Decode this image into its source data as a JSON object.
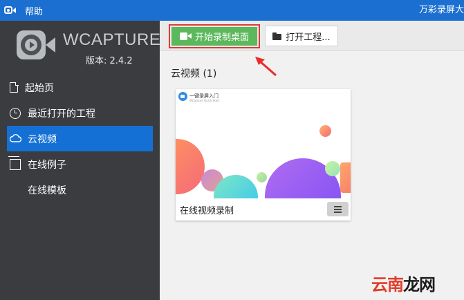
{
  "titlebar": {
    "menu_help": "帮助",
    "title": "万彩录屏大"
  },
  "sidebar": {
    "brand": "WCAPTURE",
    "version": "版本: 2.4.2",
    "items": [
      {
        "label": "起始页",
        "icon": "document-icon"
      },
      {
        "label": "最近打开的工程",
        "icon": "clock-icon"
      },
      {
        "label": "云视频",
        "icon": "cloud-icon",
        "active": true
      },
      {
        "label": "在线例子",
        "icon": "box-icon"
      },
      {
        "label": "在线模板",
        "icon": ""
      }
    ]
  },
  "toolbar": {
    "record_label": "开始录制桌面",
    "open_label": "打开工程..."
  },
  "main": {
    "section_title": "云视频 (1)",
    "cards": [
      {
        "label": "在线视频录制",
        "thumb_title": "一键录屏入门",
        "thumb_subtitle": "WCapture Quick Start"
      }
    ]
  },
  "watermark": {
    "part1": "云南",
    "part2": "龙网"
  },
  "colors": {
    "titlebar": "#1b6fd1",
    "sidebar": "#3a3c40",
    "active_item": "#1570d6",
    "record_button": "#5cb85c",
    "highlight": "#e03a3a"
  }
}
